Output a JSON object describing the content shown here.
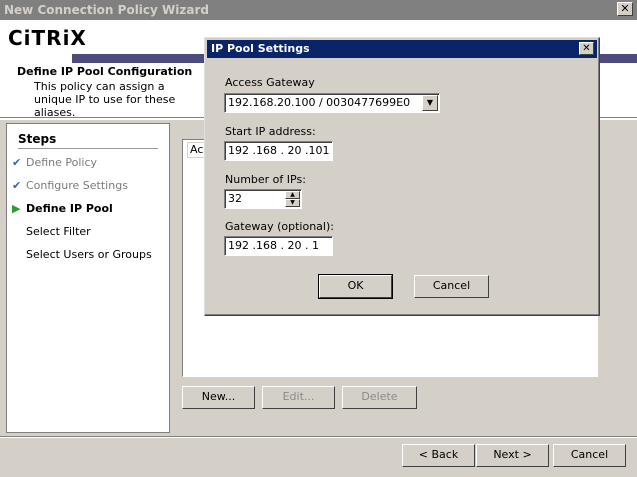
{
  "window": {
    "title": "New Connection Policy Wizard",
    "close_glyph": "✕"
  },
  "banner": {
    "logo": "CiTRiX",
    "heading": "Define IP Pool Configuration",
    "description": "This policy can assign a unique IP to use for these aliases.",
    "brand_color": "#4e4a7d"
  },
  "steps": {
    "title": "Steps",
    "items": [
      {
        "label": "Define Policy",
        "state": "done",
        "mark": "✔"
      },
      {
        "label": "Configure Settings",
        "state": "done",
        "mark": "✔"
      },
      {
        "label": "Define IP Pool",
        "state": "current",
        "mark": "▶"
      },
      {
        "label": "Select Filter",
        "state": "pending",
        "mark": ""
      },
      {
        "label": "Select Users or Groups",
        "state": "pending",
        "mark": ""
      }
    ]
  },
  "list": {
    "column_header": "Ac"
  },
  "list_buttons": {
    "new": "New...",
    "edit": "Edit...",
    "delete": "Delete"
  },
  "nav_buttons": {
    "back": "< Back",
    "next": "Next >",
    "cancel": "Cancel"
  },
  "dialog": {
    "title": "IP Pool Settings",
    "close_glyph": "✕",
    "access_gateway_label": "Access Gateway",
    "access_gateway_value": "192.168.20.100 / 0030477699E0",
    "start_ip_label": "Start IP address:",
    "start_ip_value": "192 .168 . 20 .101",
    "num_ips_label": "Number of IPs:",
    "num_ips_value": "32",
    "gateway_label": "Gateway (optional):",
    "gateway_value": "192 .168 . 20 . 1",
    "ok": "OK",
    "cancel": "Cancel",
    "titlebar_color": "#0a246a"
  }
}
